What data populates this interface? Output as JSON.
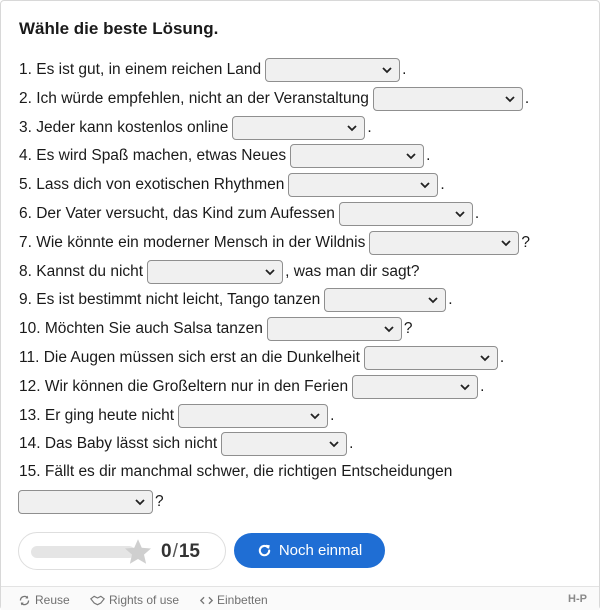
{
  "title": "Wähle die beste Lösung.",
  "questions": [
    {
      "before": "1. Es ist gut, in einem reichen Land",
      "after": "."
    },
    {
      "before": "2. Ich würde empfehlen, nicht an der Veranstaltung",
      "after": "."
    },
    {
      "before": "3. Jeder kann kostenlos online",
      "after": "."
    },
    {
      "before": "4. Es wird Spaß machen, etwas Neues",
      "after": "."
    },
    {
      "before": "5. Lass dich von exotischen Rhythmen",
      "after": "."
    },
    {
      "before": "6. Der Vater versucht, das Kind zum Aufessen",
      "after": "."
    },
    {
      "before": "7. Wie könnte ein moderner Mensch in der Wildnis",
      "after": "?"
    },
    {
      "before": "8. Kannst du nicht",
      "after": ", was man dir sagt?"
    },
    {
      "before": "9. Es ist bestimmt nicht leicht, Tango tanzen",
      "after": "."
    },
    {
      "before": "10. Möchten Sie auch Salsa tanzen",
      "after": "?"
    },
    {
      "before": "11. Die Augen müssen sich erst an die Dunkelheit",
      "after": "."
    },
    {
      "before": "12. Wir können die Großeltern nur in den Ferien",
      "after": "."
    },
    {
      "before": "13. Er ging heute nicht",
      "after": "."
    },
    {
      "before": "14. Das Baby lässt sich nicht",
      "after": "."
    },
    {
      "before": "15. Fällt es dir manchmal schwer, die richtigen Entscheidungen",
      "after": "?"
    }
  ],
  "score": {
    "current": "0",
    "separator": "/",
    "max": "15",
    "progress": 0
  },
  "retry_label": "Noch einmal",
  "footer": {
    "reuse": "Reuse",
    "rights": "Rights of use",
    "embed": "Einbetten",
    "brand": "H-P"
  },
  "colors": {
    "accent": "#1f6ed4"
  }
}
